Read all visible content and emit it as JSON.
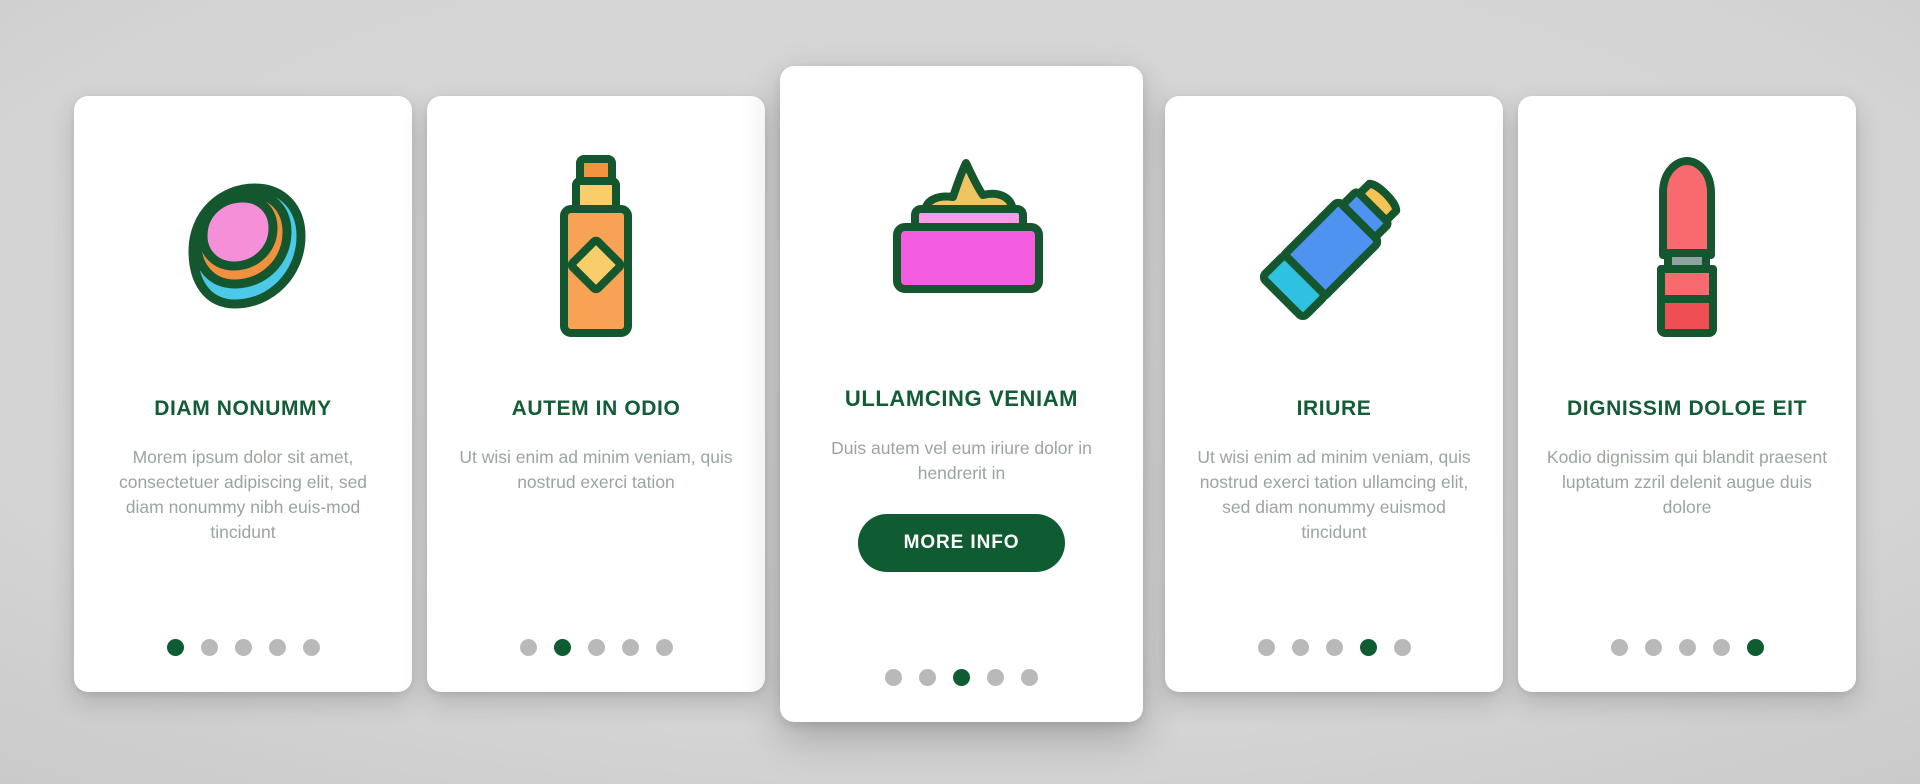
{
  "theme": {
    "background_gradient_start": "#d9d9d9",
    "background_gradient_end": "#b9b9b9",
    "card_background": "#ffffff",
    "accent_green": "#0f5c32",
    "title_green": "#135c36",
    "body_text_gray": "#9aa69c",
    "dot_inactive": "#b9b9b9",
    "icon_outline": "#14572f"
  },
  "cards": [
    {
      "id": "card-1",
      "icon_name": "cosmetic-powder-ball-icon",
      "title": "DIAM NONUMMY",
      "description": "Morem ipsum dolor sit amet, consectetuer adipiscing elit, sed diam nonummy nibh euis-mod tincidunt",
      "featured": false,
      "dots_total": 5,
      "active_dot": 1,
      "icon_colors": {
        "inner": "#f58fd8",
        "middle": "#f0913f",
        "outer": "#4cc9e8"
      }
    },
    {
      "id": "card-2",
      "icon_name": "cosmetic-bottle-icon",
      "title": "AUTEM IN ODIO",
      "description": "Ut wisi enim ad minim veniam, quis nostrud exerci tation",
      "featured": false,
      "dots_total": 5,
      "active_dot": 2,
      "icon_colors": {
        "body": "#f7a254",
        "cap": "#f9cd6a",
        "top": "#f2933f",
        "label": "#f9cd6a"
      }
    },
    {
      "id": "card-3",
      "icon_name": "cosmetic-cream-jar-icon",
      "title": "ULLAMCING VENIAM",
      "description": "Duis autem vel eum iriure dolor in hendrerit in",
      "featured": true,
      "button_label": "MORE INFO",
      "dots_total": 5,
      "active_dot": 3,
      "icon_colors": {
        "jar": "#f45ddf",
        "rim": "#fa9ae8",
        "cream": "#eec561"
      }
    },
    {
      "id": "card-4",
      "icon_name": "cosmetic-marker-pencil-icon",
      "title": "IRIURE",
      "description": "Ut wisi enim ad minim veniam, quis nostrud exerci tation ullamcing elit, sed diam nonummy euismod tincidunt",
      "featured": false,
      "dots_total": 5,
      "active_dot": 4,
      "icon_colors": {
        "body": "#4d93ef",
        "tip": "#f5c356",
        "cap": "#2ec1e0",
        "stripe": "#2ec1e0"
      }
    },
    {
      "id": "card-5",
      "icon_name": "lipstick-icon",
      "title": "DIGNISSIM DOLOE EIT",
      "description": "Kodio dignissim qui blandit praesent luptatum zzril delenit augue duis dolore",
      "featured": false,
      "dots_total": 5,
      "active_dot": 5,
      "icon_colors": {
        "stick": "#f96a6f",
        "band": "#8fa3a0",
        "base_top": "#f96a6f",
        "base_bottom": "#ef4e55"
      }
    }
  ]
}
